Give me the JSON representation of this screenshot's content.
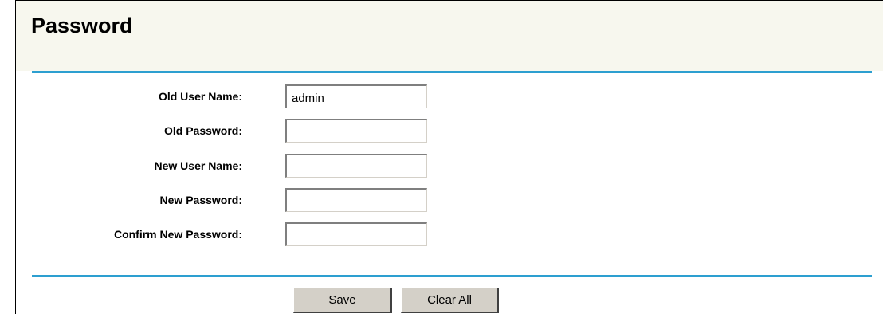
{
  "page": {
    "title": "Password"
  },
  "form": {
    "old_user_name": {
      "label": "Old User Name:",
      "value": "admin"
    },
    "old_password": {
      "label": "Old Password:",
      "value": ""
    },
    "new_user_name": {
      "label": "New User Name:",
      "value": ""
    },
    "new_password": {
      "label": "New Password:",
      "value": ""
    },
    "confirm_new_password": {
      "label": "Confirm New Password:",
      "value": ""
    }
  },
  "actions": {
    "save_label": "Save",
    "clear_all_label": "Clear All"
  }
}
